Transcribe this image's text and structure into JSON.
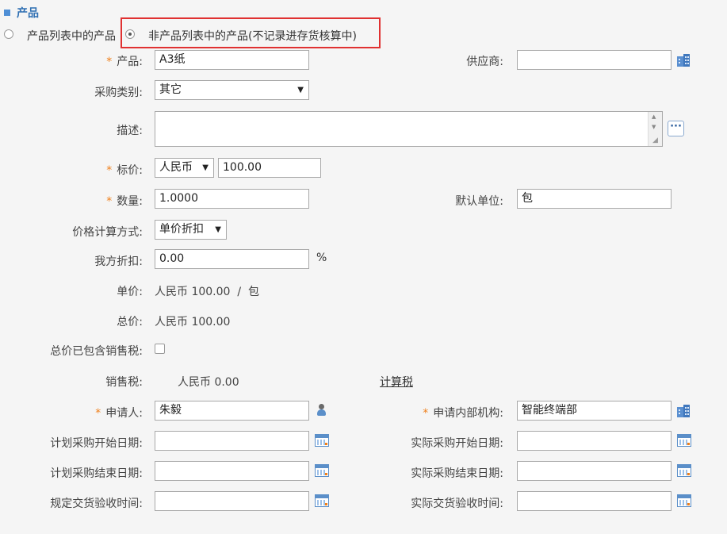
{
  "section": {
    "title": "产品"
  },
  "radios": [
    {
      "label": "产品列表中的产品",
      "checked": false
    },
    {
      "label": "非产品列表中的产品(不记录进存货核算中)",
      "checked": true
    }
  ],
  "fields": {
    "product": {
      "label": "产品:",
      "value": "A3纸",
      "required": true
    },
    "supplier": {
      "label": "供应商:",
      "value": ""
    },
    "category": {
      "label": "采购类别:",
      "value": "其它"
    },
    "description": {
      "label": "描述:",
      "value": ""
    },
    "price": {
      "label": "标价:",
      "currency": "人民币",
      "value": "100.00",
      "required": true
    },
    "quantity": {
      "label": "数量:",
      "value": "1.0000",
      "required": true
    },
    "default_unit": {
      "label": "默认单位:",
      "value": "包"
    },
    "pricing_method": {
      "label": "价格计算方式:",
      "value": "单价折扣"
    },
    "discount": {
      "label": "我方折扣:",
      "value": "0.00",
      "suffix": "%"
    },
    "unit_price": {
      "label": "单价:",
      "value": "人民币 100.00  /  包"
    },
    "total_price": {
      "label": "总价:",
      "value": "人民币 100.00"
    },
    "tax_included": {
      "label": "总价已包含销售税:",
      "checked": false
    },
    "sales_tax": {
      "label": "销售税:",
      "value": "人民币 0.00",
      "link": "计算税"
    },
    "applicant": {
      "label": "申请人:",
      "value": "朱毅",
      "required": true
    },
    "department": {
      "label": "申请内部机构:",
      "value": "智能终端部",
      "required": true
    },
    "plan_start": {
      "label": "计划采购开始日期:",
      "value": ""
    },
    "actual_start": {
      "label": "实际采购开始日期:",
      "value": ""
    },
    "plan_end": {
      "label": "计划采购结束日期:",
      "value": ""
    },
    "actual_end": {
      "label": "实际采购结束日期:",
      "value": ""
    },
    "planned_delivery": {
      "label": "规定交货验收时间:",
      "value": ""
    },
    "actual_delivery": {
      "label": "实际交货验收时间:",
      "value": ""
    }
  },
  "required_mark": "*",
  "icons": {
    "building": "building-icon",
    "calendar": "calendar-icon",
    "person": "person-icon",
    "more": "ellipsis-icon"
  },
  "colors": {
    "accent": "#2f6fb3",
    "required": "#ef7f1a",
    "highlight": "#e03131"
  }
}
